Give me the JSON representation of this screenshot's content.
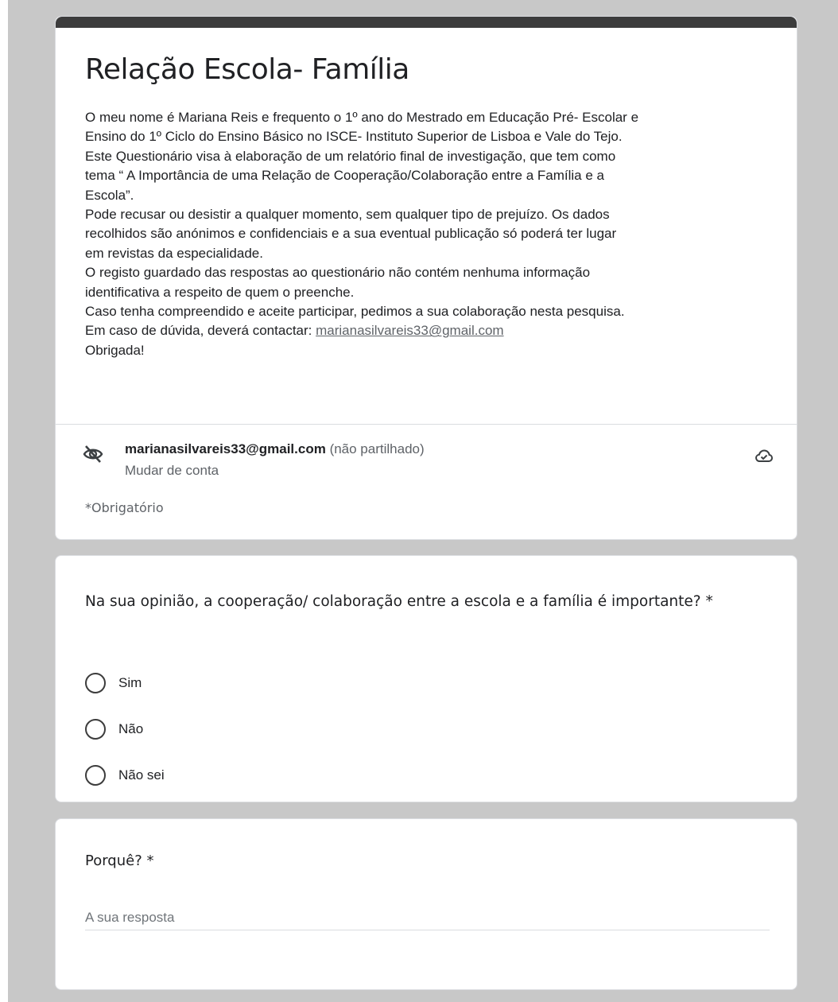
{
  "form": {
    "title": "Relação Escola- Família",
    "description_lines": [
      "O meu nome é Mariana Reis e frequento o 1º ano do Mestrado em Educação Pré- Escolar e",
      "Ensino do 1º Ciclo do Ensino Básico no ISCE- Instituto Superior de Lisboa e Vale do Tejo.",
      "Este Questionário visa à elaboração de um relatório final de investigação, que tem como",
      "tema “ A Importância de uma Relação de Cooperação/Colaboração entre a Família e a",
      "Escola”.",
      "Pode recusar ou desistir a qualquer momento, sem qualquer tipo de prejuízo. Os dados",
      "recolhidos são anónimos e confidenciais e a sua eventual publicação só poderá ter lugar",
      "em revistas da especialidade.",
      "O registo guardado das respostas ao questionário não contém nenhuma informação",
      "identificativa a respeito de quem o preenche.",
      "Caso tenha compreendido e aceite participar, pedimos a sua colaboração nesta pesquisa."
    ],
    "contact_prefix": "Em caso de dúvida, deverá contactar: ",
    "contact_email": "marianasilvareis33@gmail.com",
    "thanks": "Obrigada!"
  },
  "account": {
    "email": "marianasilvareis33@gmail.com",
    "not_shared": "(não partilhado)",
    "switch_label": "Mudar de conta",
    "icon_left": "eye-off-icon",
    "icon_right": "cloud-done-icon"
  },
  "required_note": "*Obrigatório",
  "question1": {
    "title": "Na sua opinião, a cooperação/ colaboração entre a escola e a família é importante? *",
    "options": [
      "Sim",
      "Não",
      "Não sei"
    ]
  },
  "question2": {
    "title": "Porquê? *",
    "placeholder": "A sua resposta",
    "value": ""
  },
  "colors": {
    "header_bar": "#3c3c3c",
    "background": "#c8c8c8",
    "text": "#202124",
    "muted": "#5f6368"
  }
}
